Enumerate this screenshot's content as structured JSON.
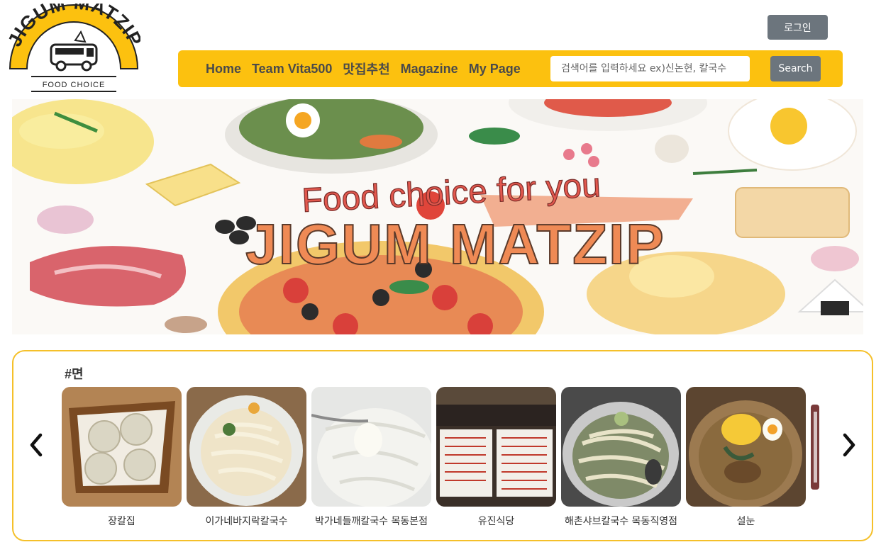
{
  "logo": {
    "top_text": "JIGUM MATZIP",
    "bottom_text": "FOOD CHOICE"
  },
  "header": {
    "login_label": "로그인"
  },
  "nav": {
    "links": [
      "Home",
      "Team Vita500",
      "맛집추천",
      "Magazine",
      "My Page"
    ],
    "search_placeholder": "검색어를 입력하세요 ex)신논현, 칼국수",
    "search_button": "Search",
    "bar_color": "#fcc10f"
  },
  "banner": {
    "tagline": "Food choice for you",
    "title": "JIGUM MATZIP"
  },
  "carousel": {
    "title": "#면",
    "border_color": "#f5c02a",
    "items": [
      {
        "name": "장칼집"
      },
      {
        "name": "이가네바지락칼국수"
      },
      {
        "name": "박가네들깨칼국수 목동본점"
      },
      {
        "name": "유진식당"
      },
      {
        "name": "해촌샤브칼국수 목동직영점"
      },
      {
        "name": "설눈"
      }
    ]
  }
}
